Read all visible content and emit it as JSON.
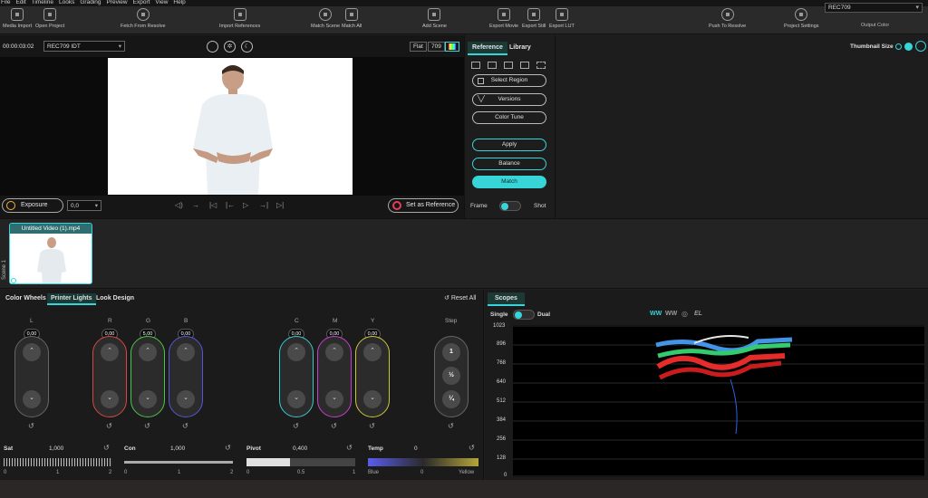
{
  "menu": [
    "File",
    "Edit",
    "Timeline",
    "Looks",
    "Grading",
    "Preview",
    "Export",
    "View",
    "Help"
  ],
  "toolbar": {
    "media_import": "Media Import",
    "open_project": "Open Project",
    "fetch_from_resolve": "Fetch From Resolve",
    "import_references": "Import References",
    "match_scene": "Match Scene",
    "match_all": "Match All",
    "add_scene": "Add Scene",
    "export_movie": "Export Movie",
    "export_still": "Export Still",
    "export_lut": "Export LUT",
    "push_to_resolve": "Push To Resolve",
    "project_settings": "Project Settings",
    "output_color_value": "REC709",
    "output_color_label": "Output Color"
  },
  "viewer": {
    "timecode": "00:00:03:02",
    "idt": "REC709 IDT",
    "flat": "Flat",
    "gamma": "709",
    "progress": 0.11,
    "exposure_label": "Exposure",
    "exposure_value": "0,0",
    "set_reference": "Set as Reference"
  },
  "reference": {
    "tab_reference": "Reference",
    "tab_library": "Library",
    "select_region": "Select Region",
    "versions": "Versions",
    "color_tune": "Color Tune",
    "apply": "Apply",
    "balance": "Balance",
    "match": "Match",
    "frame": "Frame",
    "shot": "Shot"
  },
  "library": {
    "thumbnail_size": "Thumbnail Size"
  },
  "clips": {
    "scene_label": "Scene 1",
    "clip_title": "Untitled Video (1).mp4"
  },
  "grading": {
    "tabs": [
      "Color Wheels",
      "Printer Lights",
      "Look Design"
    ],
    "reset_all": "Reset All",
    "channels": [
      {
        "name": "L",
        "value": "0,00"
      },
      {
        "name": "R",
        "value": "0,00"
      },
      {
        "name": "G",
        "value": "5,00"
      },
      {
        "name": "B",
        "value": "0,00"
      },
      {
        "name": "C",
        "value": "0,00"
      },
      {
        "name": "M",
        "value": "0,00"
      },
      {
        "name": "Y",
        "value": "0,00"
      }
    ],
    "step_label": "Step",
    "steps": [
      "1",
      "½",
      "¼"
    ],
    "sliders": [
      {
        "label": "Sat",
        "value": "1,000",
        "ticks": [
          "0",
          "1",
          "2"
        ]
      },
      {
        "label": "Con",
        "value": "1,000",
        "ticks": [
          "0",
          "1",
          "2"
        ]
      },
      {
        "label": "Pivot",
        "value": "0,400",
        "ticks": [
          "0",
          "0.5",
          "1"
        ]
      },
      {
        "label": "Temp",
        "value": "0",
        "ticks": [
          "Blue",
          "0",
          "Yellow"
        ]
      }
    ]
  },
  "scopes": {
    "tab": "Scopes",
    "single": "Single",
    "dual": "Dual",
    "mode_icons": [
      "WW",
      "WW",
      "◎",
      "EL"
    ],
    "y_ticks": [
      "1023",
      "896",
      "768",
      "640",
      "512",
      "384",
      "256",
      "128",
      "0"
    ]
  },
  "colors": {
    "accent": "#37d4d8"
  }
}
